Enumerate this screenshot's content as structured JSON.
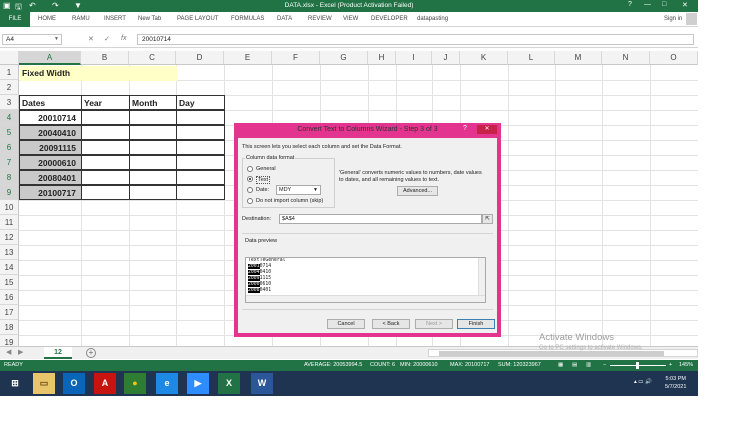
{
  "window": {
    "title": "DATA.xlsx -  Excel (Product Activation Failed)",
    "help_label": "?",
    "minimize_label": "—",
    "restore_label": "□",
    "close_label": "✕"
  },
  "quick_access": {
    "save_icon": "save-icon",
    "undo_icon": "undo-icon",
    "redo_icon": "redo-icon",
    "filter_icon": "filter-icon"
  },
  "ribbon": {
    "tabs": [
      "FILE",
      "HOME",
      "RAMU",
      "INSERT",
      "New Tab",
      "PAGE LAYOUT",
      "FORMULAS",
      "DATA",
      "REVIEW",
      "VIEW",
      "DEVELOPER",
      "datapasting"
    ],
    "signin": "Sign in"
  },
  "formula_bar": {
    "name_box": "A4",
    "cancel_label": "✕",
    "enter_label": "✓",
    "fx_label": "fx",
    "value": "20010714"
  },
  "grid": {
    "columns": [
      "A",
      "B",
      "C",
      "D",
      "E",
      "F",
      "G",
      "H",
      "I",
      "J",
      "K",
      "L",
      "M",
      "N",
      "O"
    ],
    "rows": [
      "1",
      "2",
      "3",
      "4",
      "5",
      "6",
      "7",
      "8",
      "9",
      "10",
      "11",
      "12",
      "13",
      "14",
      "15",
      "16",
      "17",
      "18",
      "19"
    ],
    "a1": "Fixed Width",
    "headers": [
      "Dates",
      "Year",
      "Month",
      "Day"
    ],
    "dates": [
      "20010714",
      "20040410",
      "20091115",
      "20000610",
      "20080401",
      "20100717"
    ]
  },
  "dialog": {
    "title": "Convert Text to Columns Wizard - Step 3 of 3",
    "help_label": "?",
    "close_label": "✕",
    "intro": "This screen lets you select each column and set the Data Format.",
    "format_group_label": "Column data format",
    "options": {
      "general": "General",
      "text": "Text",
      "date": "Date:",
      "skip": "Do not import column (skip)"
    },
    "date_format": "MDY",
    "description_line1": "'General' converts numeric values to numbers, date values",
    "description_line2": "to dates, and all remaining values to text.",
    "advanced_label": "Advanced...",
    "destination_label": "Destination:",
    "destination_value": "$A$4",
    "preview_label": "Data preview",
    "preview_header": [
      "Text",
      "Te",
      "General"
    ],
    "preview_rows": [
      [
        "2001",
        "07",
        "14"
      ],
      [
        "2004",
        "04",
        "10"
      ],
      [
        "2009",
        "11",
        "15"
      ],
      [
        "2000",
        "06",
        "10"
      ],
      [
        "2008",
        "04",
        "01"
      ]
    ],
    "cancel_label": "Cancel",
    "back_label": "< Back",
    "next_label": "Next >",
    "finish_label": "Finish"
  },
  "sheets": {
    "active": "12",
    "add_label": "+"
  },
  "watermark": {
    "line1": "Activate Windows",
    "line2": "Go to PC settings to activate Windows."
  },
  "status": {
    "ready": "READY",
    "average": "AVERAGE: 20053994.5",
    "count": "COUNT: 6",
    "min": "MIN: 20000610",
    "max": "MAX: 20100717",
    "sum": "SUM: 120323967",
    "zoom_minus": "−",
    "zoom_plus": "+",
    "zoom": "145%"
  },
  "taskbar": {
    "time": "5:03 PM",
    "date": "5/7/2021",
    "apps": [
      "start-icon",
      "file-explorer-icon",
      "outlook-icon",
      "acrobat-icon",
      "chrome-icon",
      "internet-explorer-icon",
      "zoom-icon",
      "excel-icon",
      "word-icon"
    ]
  },
  "colors": {
    "excel_green": "#217346",
    "dialog_border": "#e3348f",
    "taskbar": "#1f3450"
  }
}
